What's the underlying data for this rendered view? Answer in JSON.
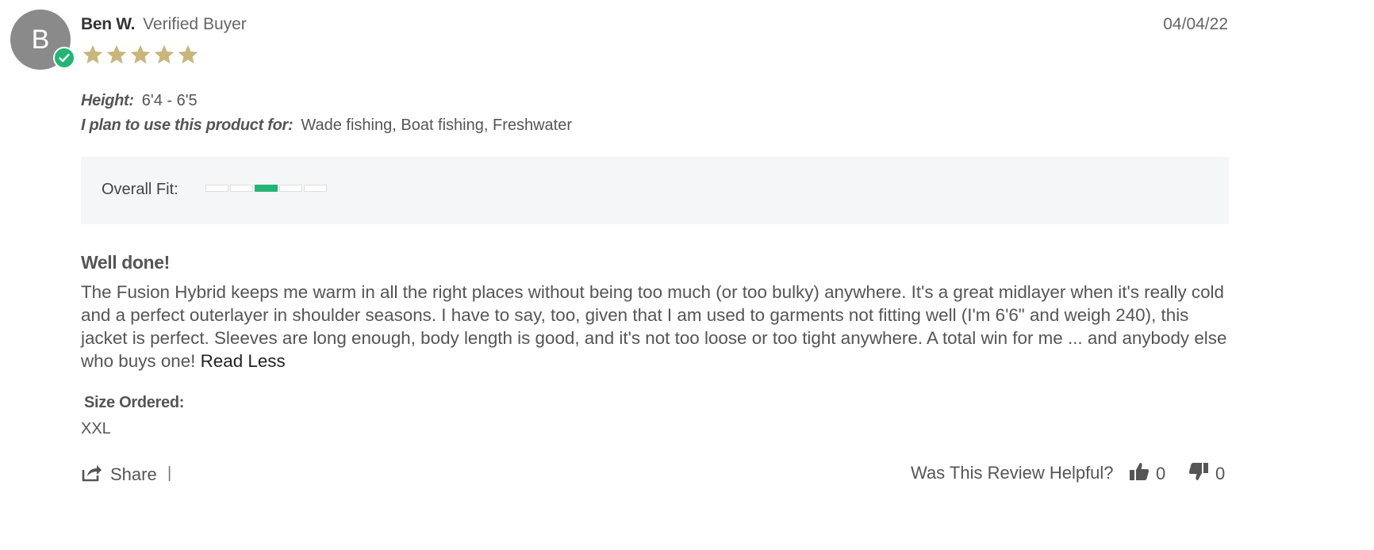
{
  "review": {
    "avatar_initial": "B",
    "author": "Ben W.",
    "verified_label": "Verified Buyer",
    "date": "04/04/22",
    "rating": 5,
    "rating_max": 5,
    "star_color": "#c9b67d",
    "attributes": [
      {
        "label": "Height:",
        "value": "6'4 - 6'5"
      },
      {
        "label": "I plan to use this product for:",
        "value": "Wade fishing, Boat fishing, Freshwater"
      }
    ],
    "overall_fit": {
      "label": "Overall Fit:",
      "selected_segment": 3,
      "segments": 5,
      "accent": "#22b573"
    },
    "title": "Well done!",
    "body": "The Fusion Hybrid keeps me warm in all the right places without being too much (or too bulky) anywhere. It's a great midlayer when it's really cold and a perfect outerlayer in shoulder seasons. I have to say, too, given that I am used to garments not fitting well (I'm 6'6\" and weigh 240), this jacket is perfect. Sleeves are long enough, body length is good, and it's not too loose or too tight anywhere. A total win for me ... and anybody else who buys one!",
    "read_less_label": "Read Less",
    "size_label": "Size Ordered:",
    "size_value": "XXL"
  },
  "footer": {
    "share_label": "Share",
    "divider": "|",
    "helpful_question": "Was This Review Helpful?",
    "upvotes": "0",
    "downvotes": "0",
    "icons": [
      "share-icon",
      "thumbs-up-icon",
      "thumbs-down-icon"
    ]
  }
}
